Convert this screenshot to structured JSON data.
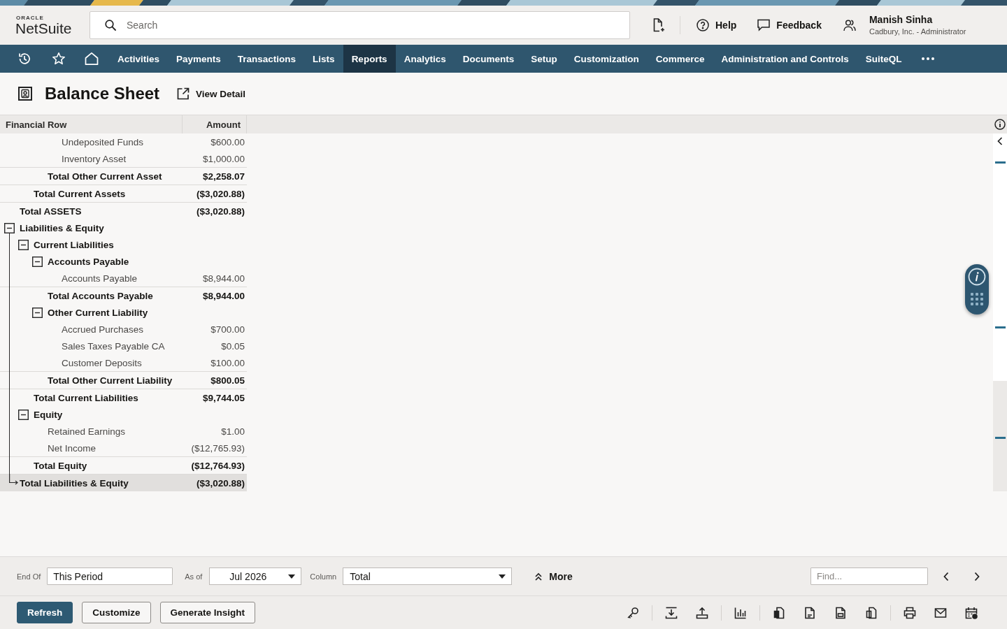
{
  "header": {
    "logo": {
      "top": "ORACLE",
      "name": "NetSuite"
    },
    "search": {
      "placeholder": "Search"
    },
    "help": "Help",
    "feedback": "Feedback",
    "user": {
      "name": "Manish Sinha",
      "role": "Cadbury, Inc. - Administrator"
    }
  },
  "nav": {
    "items": [
      {
        "label": "Activities",
        "selected": false
      },
      {
        "label": "Payments",
        "selected": false
      },
      {
        "label": "Transactions",
        "selected": false
      },
      {
        "label": "Lists",
        "selected": false
      },
      {
        "label": "Reports",
        "selected": true
      },
      {
        "label": "Analytics",
        "selected": false
      },
      {
        "label": "Documents",
        "selected": false
      },
      {
        "label": "Setup",
        "selected": false
      },
      {
        "label": "Customization",
        "selected": false
      },
      {
        "label": "Commerce",
        "selected": false
      },
      {
        "label": "Administration and Controls",
        "selected": false
      },
      {
        "label": "SuiteQL",
        "selected": false
      }
    ]
  },
  "report": {
    "title": "Balance Sheet",
    "view_detail": "View Detail"
  },
  "table": {
    "columns": [
      "Financial Row",
      "Amount"
    ],
    "rows": [
      {
        "kind": "section",
        "children": [
          {
            "kind": "section",
            "children": [
              {
                "kind": "section",
                "children": [
                  {
                    "kind": "line",
                    "label": "Undeposited Funds",
                    "amount": "$600.00"
                  },
                  {
                    "kind": "line",
                    "label": "Inventory Asset",
                    "amount": "$1,000.00"
                  }
                ],
                "total": {
                  "label": "Total Other Current Asset",
                  "amount": "$2,258.07",
                  "highlighted": false
                }
              }
            ],
            "total": {
              "label": "Total Current Assets",
              "amount": "($3,020.88)",
              "highlighted": false
            }
          }
        ],
        "total": {
          "label": "Total ASSETS",
          "amount": "($3,020.88)",
          "highlighted": false
        }
      },
      {
        "kind": "section",
        "label": "Liabilities & Equity",
        "expanded": true,
        "children": [
          {
            "kind": "section",
            "label": "Current Liabilities",
            "expanded": true,
            "children": [
              {
                "kind": "section",
                "label": "Accounts Payable",
                "expanded": true,
                "children": [
                  {
                    "kind": "line",
                    "label": "Accounts Payable",
                    "amount": "$8,944.00"
                  }
                ],
                "total": {
                  "label": "Total Accounts Payable",
                  "amount": "$8,944.00",
                  "highlighted": false
                }
              },
              {
                "kind": "section",
                "label": "Other Current Liability",
                "expanded": true,
                "children": [
                  {
                    "kind": "line",
                    "label": "Accrued Purchases",
                    "amount": "$700.00"
                  },
                  {
                    "kind": "line",
                    "label": "Sales Taxes Payable CA",
                    "amount": "$0.05"
                  },
                  {
                    "kind": "line",
                    "label": "Customer Deposits",
                    "amount": "$100.00"
                  }
                ],
                "total": {
                  "label": "Total Other Current Liability",
                  "amount": "$800.05",
                  "highlighted": false
                }
              }
            ],
            "total": {
              "label": "Total Current Liabilities",
              "amount": "$9,744.05",
              "highlighted": false
            }
          },
          {
            "kind": "section",
            "label": "Equity",
            "expanded": true,
            "children": [
              {
                "kind": "line",
                "label": "Retained Earnings",
                "amount": "$1.00"
              },
              {
                "kind": "line",
                "label": "Net Income",
                "amount": "($12,765.93)"
              }
            ],
            "total": {
              "label": "Total Equity",
              "amount": "($12,764.93)",
              "highlighted": false
            }
          }
        ],
        "total": {
          "label": "Total Liabilities & Equity",
          "amount": "($3,020.88)",
          "highlighted": true
        }
      }
    ]
  },
  "filters": {
    "end_of": {
      "label": "End Of",
      "value": "This Period"
    },
    "as_of": {
      "label": "As of",
      "value": "Jul 2026"
    },
    "column": {
      "label": "Column",
      "value": "Total"
    },
    "more": "More",
    "find": {
      "placeholder": "Find..."
    }
  },
  "actions": [
    {
      "label": "Refresh",
      "kind": "primary"
    },
    {
      "label": "Customize",
      "kind": "secondary"
    },
    {
      "label": "Generate Insight",
      "kind": "secondary"
    }
  ]
}
